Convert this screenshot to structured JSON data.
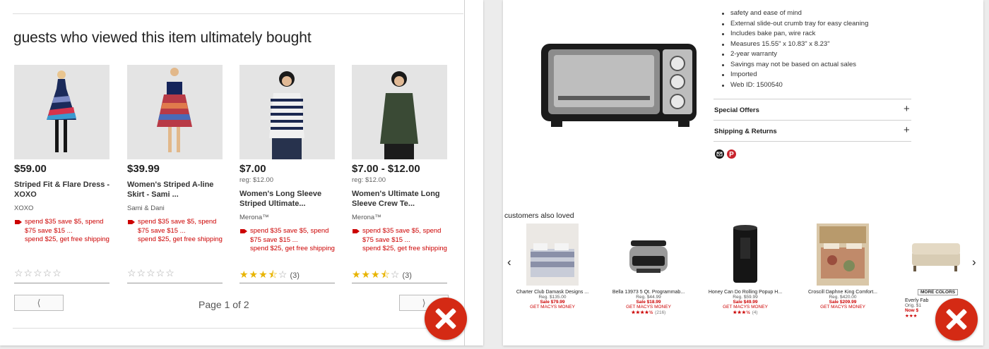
{
  "left": {
    "heading": "guests who viewed this item ultimately bought",
    "products": [
      {
        "price": "$59.00",
        "reg": "",
        "name": "Striped Fit & Flare Dress - XOXO",
        "brand": "XOXO",
        "promo": "spend $35 save $5, spend $75 save $15 ...\nspend $25, get free shipping",
        "rating": 0,
        "count": ""
      },
      {
        "price": "$39.99",
        "reg": "",
        "name": "Women's Striped A-line Skirt - Sami ...",
        "brand": "Sami & Dani",
        "promo": "spend $35 save $5, spend $75 save $15 ...\nspend $25, get free shipping",
        "rating": 0,
        "count": ""
      },
      {
        "price": "$7.00",
        "reg": "reg: $12.00",
        "name": "Women's Long Sleeve Striped Ultimate...",
        "brand": "Merona™",
        "promo": "spend $35 save $5, spend $75 save $15 ...\nspend $25, get free shipping",
        "rating": 3.5,
        "count": "(3)"
      },
      {
        "price": "$7.00 - $12.00",
        "reg": "reg: $12.00",
        "name": "Women's Ultimate Long Sleeve Crew Te...",
        "brand": "Merona™",
        "promo": "spend $35 save $5, spend $75 save $15 ...\nspend $25, get free shipping",
        "rating": 3.5,
        "count": "(3)"
      }
    ],
    "pager": {
      "prev": "⟨",
      "next": "⟩",
      "text": "Page 1 of 2"
    }
  },
  "right": {
    "features": [
      "safety and ease of mind",
      "External slide-out crumb tray for easy cleaning",
      "Includes bake pan, wire rack",
      "Measures 15.55\" x 10.83\" x 8.23\"",
      "2-year warranty",
      "Savings may not be based on actual sales",
      "Imported",
      "Web ID: 1500540"
    ],
    "special_offers": "Special Offers",
    "shipping_returns": "Shipping & Returns",
    "plus": "+",
    "carousel_title": "customers also loved",
    "prev_arrow": "‹",
    "next_arrow": "›",
    "products": [
      {
        "name": "Charter Club Damask Designs ...",
        "reg": "Reg. $135.00",
        "sale": "Sale $79.99",
        "money": "GET MACYS MONEY",
        "stars": "",
        "count": ""
      },
      {
        "name": "Bella 13973 5 Qt. Programmab...",
        "reg": "Reg. $44.99",
        "sale": "Sale $18.99",
        "money": "GET MACYS MONEY",
        "stars": "★★★★½",
        "count": "(216)"
      },
      {
        "name": "Honey Can Do Rolling Popup H...",
        "reg": "Reg. $59.99",
        "sale": "Sale $49.99",
        "money": "GET MACYS MONEY",
        "stars": "★★★½",
        "count": "(4)"
      },
      {
        "name": "Croscill Daphne King Comfort...",
        "reg": "Reg. $420.00",
        "sale": "Sale $209.99",
        "money": "GET MACYS MONEY",
        "stars": "",
        "count": ""
      },
      {
        "name": "Everly Fab",
        "reg": "Orig. $1",
        "sale": "Now $",
        "money": "",
        "stars": "★★★",
        "count": "",
        "badge": "MORE COLORS"
      }
    ]
  },
  "colors": {
    "sale_red": "#cc0000",
    "close_red": "#d42a14",
    "star_gold": "#e8b400"
  }
}
